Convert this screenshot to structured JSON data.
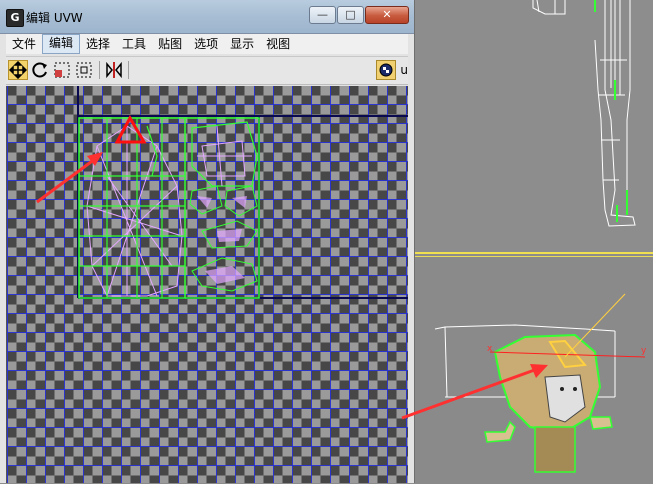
{
  "window": {
    "icon_letter": "G",
    "title": "编辑 UVW",
    "controls": {
      "minimize": "—",
      "maximize": "□",
      "close": "✕"
    }
  },
  "menu": {
    "items": [
      {
        "label": "文件",
        "active": false
      },
      {
        "label": "编辑",
        "active": true
      },
      {
        "label": "选择",
        "active": false
      },
      {
        "label": "工具",
        "active": false
      },
      {
        "label": "贴图",
        "active": false
      },
      {
        "label": "选项",
        "active": false
      },
      {
        "label": "显示",
        "active": false
      },
      {
        "label": "视图",
        "active": false
      }
    ]
  },
  "toolbar": {
    "tools": [
      "move-icon",
      "rotate-icon",
      "scale-icon",
      "freeform-icon",
      "mirror-icon"
    ],
    "texture_picker": "texture-checker-icon",
    "overflow_label": "u"
  },
  "viewport": {
    "axis_x_label": "x",
    "axis_y_label": "y"
  },
  "colors": {
    "uv_seam": "#33ff33",
    "uv_edge": "#e3a8ff",
    "grid": "#2832d2",
    "highlight_triangle": "#ff1010",
    "arrow": "#ff3030",
    "viewport_divider": "#f0e050"
  }
}
